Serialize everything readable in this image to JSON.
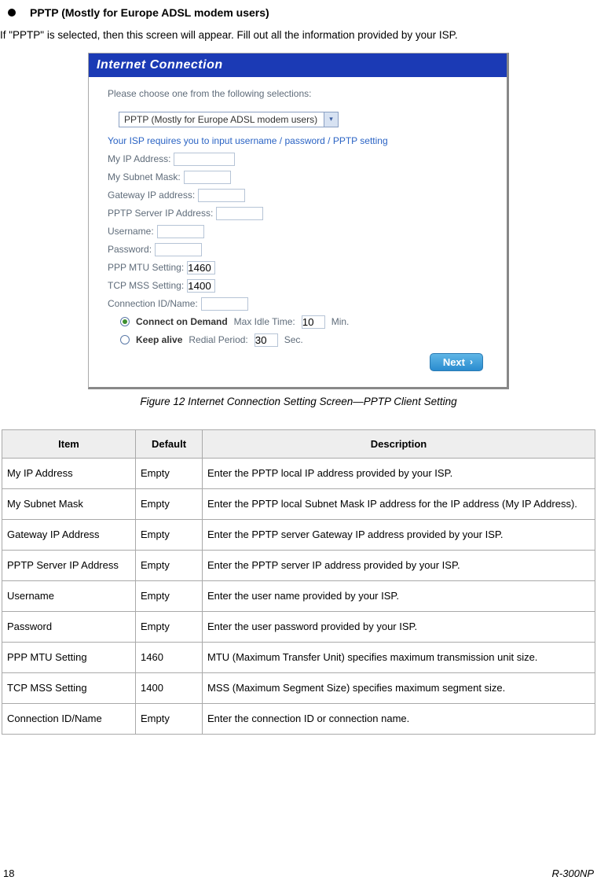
{
  "heading": "PPTP    (Mostly for Europe ADSL modem users)",
  "intro": "If \"PPTP\" is selected, then this screen will appear. Fill out all the information provided by your ISP.",
  "screenshot": {
    "title": "Internet Connection",
    "prompt": "Please choose one from the following selections:",
    "select_value": "PPTP (Mostly for Europe ADSL modem users)",
    "isp_note": "Your ISP requires you to input username / password / PPTP setting",
    "labels": {
      "my_ip": "My IP Address:",
      "subnet": "My Subnet Mask:",
      "gateway": "Gateway IP address:",
      "server": "PPTP Server IP Address:",
      "user": "Username:",
      "pass": "Password:",
      "mtu": "PPP MTU Setting:",
      "mss": "TCP MSS Setting:",
      "conn": "Connection ID/Name:",
      "cod": "Connect on Demand",
      "cod_suffix": "Max Idle Time:",
      "cod_unit": "Min.",
      "keep": "Keep alive",
      "keep_suffix": "Redial Period:",
      "keep_unit": "Sec."
    },
    "values": {
      "mtu": "1460",
      "mss": "1400",
      "idle": "10",
      "redial": "30"
    },
    "next": "Next"
  },
  "caption": "Figure 12 Internet Connection Setting Screen—PPTP Client Setting",
  "table": {
    "headers": {
      "item": "Item",
      "default": "Default",
      "desc": "Description"
    },
    "rows": [
      {
        "item": "My IP Address",
        "default": "Empty",
        "desc": "Enter the PPTP local IP address provided by your ISP."
      },
      {
        "item": "My Subnet Mask",
        "default": "Empty",
        "desc": "Enter the PPTP local Subnet Mask IP address for the IP address (My IP Address)."
      },
      {
        "item": "Gateway IP Address",
        "default": "Empty",
        "desc": "Enter the PPTP server Gateway IP address provided by your ISP."
      },
      {
        "item": "PPTP Server IP Address",
        "default": "Empty",
        "desc": "Enter the PPTP server IP address provided by your ISP."
      },
      {
        "item": "Username",
        "default": "Empty",
        "desc": "Enter the user name provided by your ISP."
      },
      {
        "item": "Password",
        "default": "Empty",
        "desc": "Enter the user password provided by your ISP."
      },
      {
        "item": "PPP MTU Setting",
        "default": "1460",
        "desc": "MTU (Maximum Transfer Unit) specifies maximum transmission unit size."
      },
      {
        "item": "TCP MSS Setting",
        "default": "1400",
        "desc": "MSS (Maximum Segment Size) specifies maximum segment size."
      },
      {
        "item": "Connection ID/Name",
        "default": "Empty",
        "desc": "Enter the connection ID or connection name."
      }
    ]
  },
  "footer": {
    "page": "18",
    "model": "R-300NP"
  }
}
